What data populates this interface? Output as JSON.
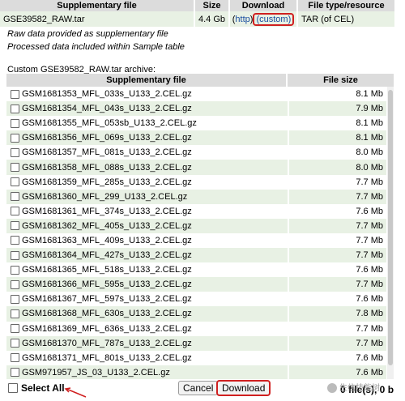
{
  "top_table": {
    "headers": [
      "Supplementary file",
      "Size",
      "Download",
      "File type/resource"
    ],
    "row": {
      "file": "GSE39582_RAW.tar",
      "size": "4.4 Gb",
      "download_open": "(",
      "http_link": "http",
      "download_mid": ")",
      "custom_link": "(custom)",
      "type": "TAR (of CEL)"
    }
  },
  "notes": {
    "raw": "Raw data provided as supplementary file",
    "processed": "Processed data included within Sample table"
  },
  "archive": {
    "title": "Custom GSE39582_RAW.tar archive:",
    "headers": {
      "file": "Supplementary file",
      "size": "File size"
    },
    "files": [
      {
        "name": "GSM1681353_MFL_033s_U133_2.CEL.gz",
        "size": "8.1 Mb"
      },
      {
        "name": "GSM1681354_MFL_043s_U133_2.CEL.gz",
        "size": "7.9 Mb"
      },
      {
        "name": "GSM1681355_MFL_053sb_U133_2.CEL.gz",
        "size": "8.1 Mb"
      },
      {
        "name": "GSM1681356_MFL_069s_U133_2.CEL.gz",
        "size": "8.1 Mb"
      },
      {
        "name": "GSM1681357_MFL_081s_U133_2.CEL.gz",
        "size": "8.0 Mb"
      },
      {
        "name": "GSM1681358_MFL_088s_U133_2.CEL.gz",
        "size": "8.0 Mb"
      },
      {
        "name": "GSM1681359_MFL_285s_U133_2.CEL.gz",
        "size": "7.7 Mb"
      },
      {
        "name": "GSM1681360_MFL_299_U133_2.CEL.gz",
        "size": "7.7 Mb"
      },
      {
        "name": "GSM1681361_MFL_374s_U133_2.CEL.gz",
        "size": "7.6 Mb"
      },
      {
        "name": "GSM1681362_MFL_405s_U133_2.CEL.gz",
        "size": "7.7 Mb"
      },
      {
        "name": "GSM1681363_MFL_409s_U133_2.CEL.gz",
        "size": "7.7 Mb"
      },
      {
        "name": "GSM1681364_MFL_427s_U133_2.CEL.gz",
        "size": "7.7 Mb"
      },
      {
        "name": "GSM1681365_MFL_518s_U133_2.CEL.gz",
        "size": "7.6 Mb"
      },
      {
        "name": "GSM1681366_MFL_595s_U133_2.CEL.gz",
        "size": "7.7 Mb"
      },
      {
        "name": "GSM1681367_MFL_597s_U133_2.CEL.gz",
        "size": "7.6 Mb"
      },
      {
        "name": "GSM1681368_MFL_630s_U133_2.CEL.gz",
        "size": "7.8 Mb"
      },
      {
        "name": "GSM1681369_MFL_636s_U133_2.CEL.gz",
        "size": "7.7 Mb"
      },
      {
        "name": "GSM1681370_MFL_787s_U133_2.CEL.gz",
        "size": "7.7 Mb"
      },
      {
        "name": "GSM1681371_MFL_801s_U133_2.CEL.gz",
        "size": "7.6 Mb"
      },
      {
        "name": "GSM971957_JS_03_U133_2.CEL.gz",
        "size": "7.6 Mb"
      }
    ]
  },
  "bottom": {
    "select_all": "Select All",
    "cancel": "Cancel",
    "download": "Download",
    "files_count": "0 file(s), 0 b"
  },
  "watermark": "生信技能树",
  "colors": {
    "highlight": "#d02020",
    "row_alt": "#e8f1e4",
    "header": "#dcdcdc",
    "link": "#1a4ea0"
  }
}
